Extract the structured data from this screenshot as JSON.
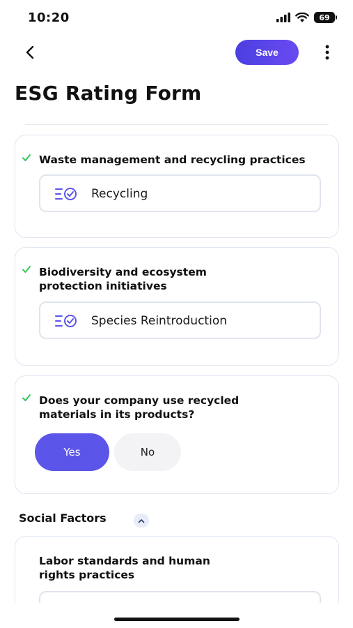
{
  "status_bar": {
    "time": "10:20",
    "battery": "69"
  },
  "header": {
    "save_label": "Save"
  },
  "page": {
    "title": "ESG Rating Form"
  },
  "cards": [
    {
      "question": "Waste management and recycling practices",
      "answer": "Recycling",
      "completed": true
    },
    {
      "question_line1": "Biodiversity and ecosystem",
      "question_line2": "protection initiatives",
      "answer": "Species Reintroduction",
      "completed": true
    },
    {
      "question_line1": "Does your company use recycled",
      "question_line2": "materials in its products?",
      "options": [
        "Yes",
        "No"
      ],
      "selected": "Yes",
      "completed": true
    }
  ],
  "social_section": {
    "title": "Social Factors",
    "expanded": true,
    "card": {
      "question_line1": "Labor standards and human",
      "question_line2": "rights practices"
    }
  },
  "colors": {
    "accent": "#5b55ea",
    "check": "#34c759",
    "card_border": "#dfe6f1"
  },
  "icons": [
    "back-arrow-icon",
    "more-vertical-icon",
    "checkmark-icon",
    "list-check-icon",
    "chevron-up-icon",
    "signal-icon",
    "wifi-icon",
    "battery-icon"
  ]
}
